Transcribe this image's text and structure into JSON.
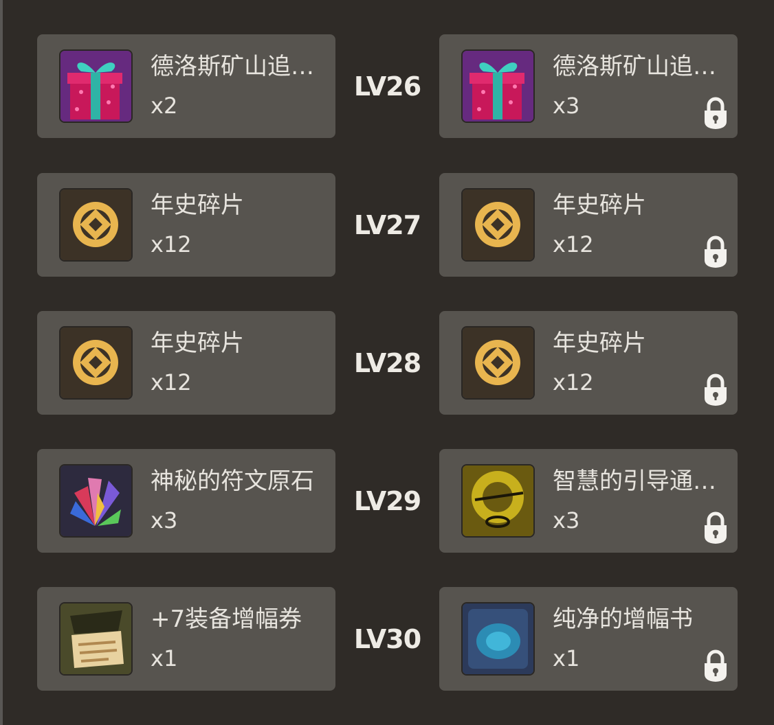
{
  "rows": [
    {
      "level": "LV26",
      "free": {
        "name": "德洛斯矿山追…",
        "count": "x2",
        "icon": "gift-box-icon"
      },
      "paid": {
        "name": "德洛斯矿山追…",
        "count": "x3",
        "icon": "gift-box-icon",
        "locked": true
      }
    },
    {
      "level": "LV27",
      "free": {
        "name": "年史碎片",
        "count": "x12",
        "icon": "chronicle-fragment-icon"
      },
      "paid": {
        "name": "年史碎片",
        "count": "x12",
        "icon": "chronicle-fragment-icon",
        "locked": true
      }
    },
    {
      "level": "LV28",
      "free": {
        "name": "年史碎片",
        "count": "x12",
        "icon": "chronicle-fragment-icon"
      },
      "paid": {
        "name": "年史碎片",
        "count": "x12",
        "icon": "chronicle-fragment-icon",
        "locked": true
      }
    },
    {
      "level": "LV29",
      "free": {
        "name": "神秘的符文原石",
        "count": "x3",
        "icon": "rune-stone-icon"
      },
      "paid": {
        "name": "智慧的引导通…",
        "count": "x3",
        "icon": "free-ticket-icon",
        "locked": true
      }
    },
    {
      "level": "LV30",
      "free": {
        "name": "+7装备增幅券",
        "count": "x1",
        "icon": "amplify-ticket-icon"
      },
      "paid": {
        "name": "纯净的增幅书",
        "count": "x1",
        "icon": "amplify-book-icon",
        "locked": true
      }
    }
  ],
  "colors": {
    "background": "#2f2b27",
    "card": "#57544f",
    "text": "#e7e4de"
  }
}
